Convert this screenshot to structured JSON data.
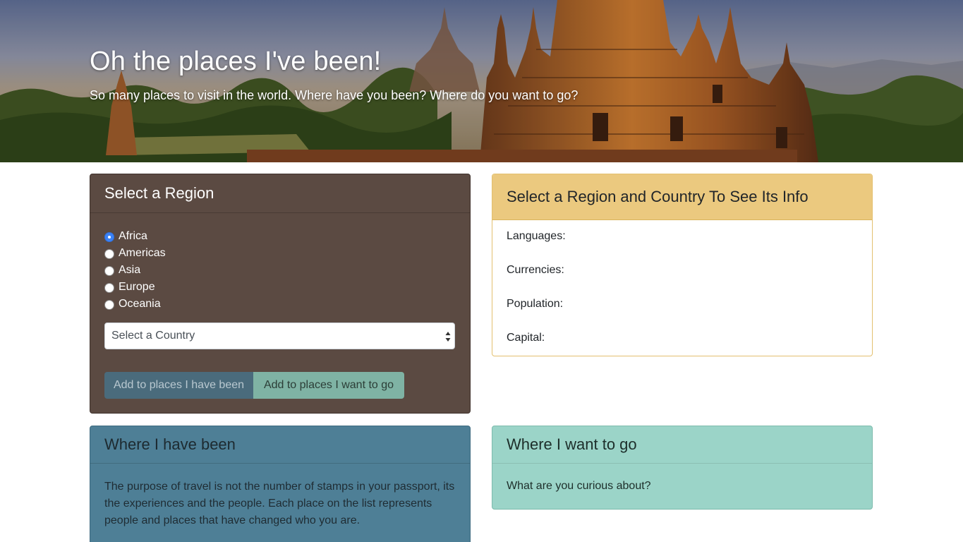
{
  "hero": {
    "title": "Oh the places I've been!",
    "subtitle": "So many places to visit in the world. Where have you been? Where do you want to go?"
  },
  "region_card": {
    "title": "Select a Region",
    "regions": [
      {
        "label": "Africa",
        "checked": true
      },
      {
        "label": "Americas",
        "checked": false
      },
      {
        "label": "Asia",
        "checked": false
      },
      {
        "label": "Europe",
        "checked": false
      },
      {
        "label": "Oceania",
        "checked": false
      }
    ],
    "country_select": {
      "selected": "Select a Country"
    },
    "buttons": {
      "been": "Add to places I have been",
      "go": "Add to places I want to go"
    }
  },
  "info_card": {
    "title": "Select a Region and Country To See Its Info",
    "fields": [
      "Languages:",
      "Currencies:",
      "Population:",
      "Capital:"
    ]
  },
  "been_card": {
    "title": "Where I have been",
    "text": "The purpose of travel is not the number of stamps in your passport, its the experiences and the people. Each place on the list represents people and places that have changed who you are."
  },
  "go_card": {
    "title": "Where I want to go",
    "text": "What are you curious about?"
  },
  "colors": {
    "region_card_bg": "#5b4a42",
    "info_header_bg": "#ebc97f",
    "been_card_bg": "#4e7f96",
    "go_card_bg": "#9bd4c8",
    "radio_checked": "#3b82f6"
  }
}
